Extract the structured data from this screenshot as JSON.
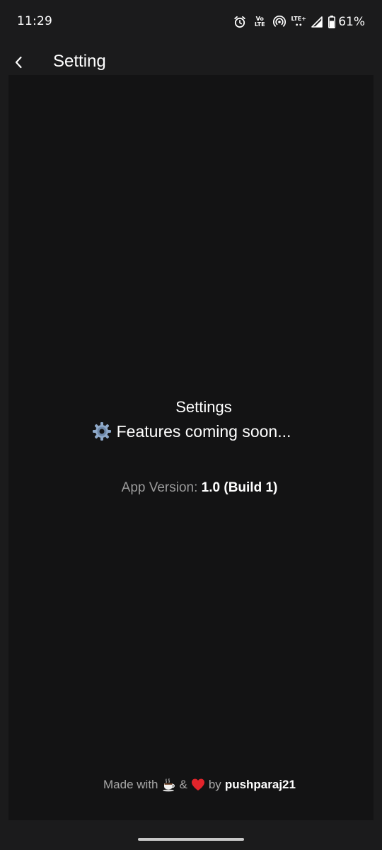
{
  "status_bar": {
    "time": "11:29",
    "volte_top": "Vo",
    "volte_bottom": "LTE",
    "lte_label": "LTE+",
    "battery_percent": "61%",
    "battery_level": 0.61,
    "icons": [
      "alarm-icon",
      "volte-icon",
      "hotspot-icon",
      "lte-plus-icon",
      "signal-icon",
      "battery-icon"
    ]
  },
  "app_bar": {
    "title": "Setting",
    "back_icon": "chevron-left-icon"
  },
  "main": {
    "heading": "Settings",
    "gear_icon": "gear-icon",
    "message": "Features coming soon...",
    "version_label": "App Version:",
    "version_value": "1.0 (Build 1)"
  },
  "footer": {
    "made_with": "Made with",
    "ampersand": "&",
    "by": "by",
    "author": "pushparaj21",
    "icons": [
      "coffee-icon",
      "heart-icon"
    ]
  },
  "colors": {
    "background": "#1b1b1c",
    "content_background": "#131314",
    "text_primary": "#ffffff",
    "text_muted": "#9b9b9b",
    "heart": "#e3242b"
  }
}
